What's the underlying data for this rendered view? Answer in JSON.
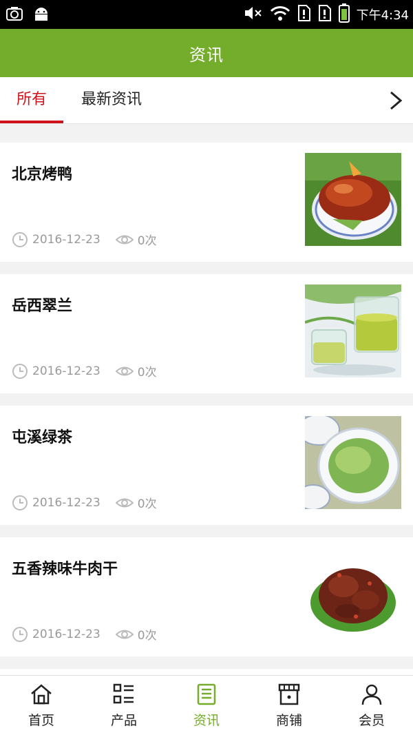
{
  "status_bar": {
    "time": "下午4:34",
    "left_icons": [
      "screenshot-icon",
      "android-icon"
    ],
    "right_icons": [
      "mute-icon",
      "wifi-icon",
      "sim1-icon",
      "sim2-icon",
      "battery-icon"
    ]
  },
  "header": {
    "title": "资讯"
  },
  "tabs": [
    {
      "label": "所有",
      "active": true
    },
    {
      "label": "最新资讯",
      "active": false
    }
  ],
  "articles": [
    {
      "title": "北京烤鸭",
      "date": "2016-12-23",
      "views": "0次",
      "thumb": "roast-duck"
    },
    {
      "title": "岳西翠兰",
      "date": "2016-12-23",
      "views": "0次",
      "thumb": "green-tea-cups"
    },
    {
      "title": "屯溪绿茶",
      "date": "2016-12-23",
      "views": "0次",
      "thumb": "green-tea-bowl"
    },
    {
      "title": "五香辣味牛肉干",
      "date": "2016-12-23",
      "views": "0次",
      "thumb": "spicy-beef-jerky"
    }
  ],
  "bottom_nav": [
    {
      "label": "首页",
      "icon": "home-icon",
      "active": false
    },
    {
      "label": "产品",
      "icon": "product-list-icon",
      "active": false
    },
    {
      "label": "资讯",
      "icon": "news-icon",
      "active": true
    },
    {
      "label": "商铺",
      "icon": "shop-icon",
      "active": false
    },
    {
      "label": "会员",
      "icon": "member-icon",
      "active": false
    }
  ],
  "colors": {
    "brand_green": "#74ad2b",
    "active_red": "#d0121b",
    "meta_gray": "#999999"
  }
}
